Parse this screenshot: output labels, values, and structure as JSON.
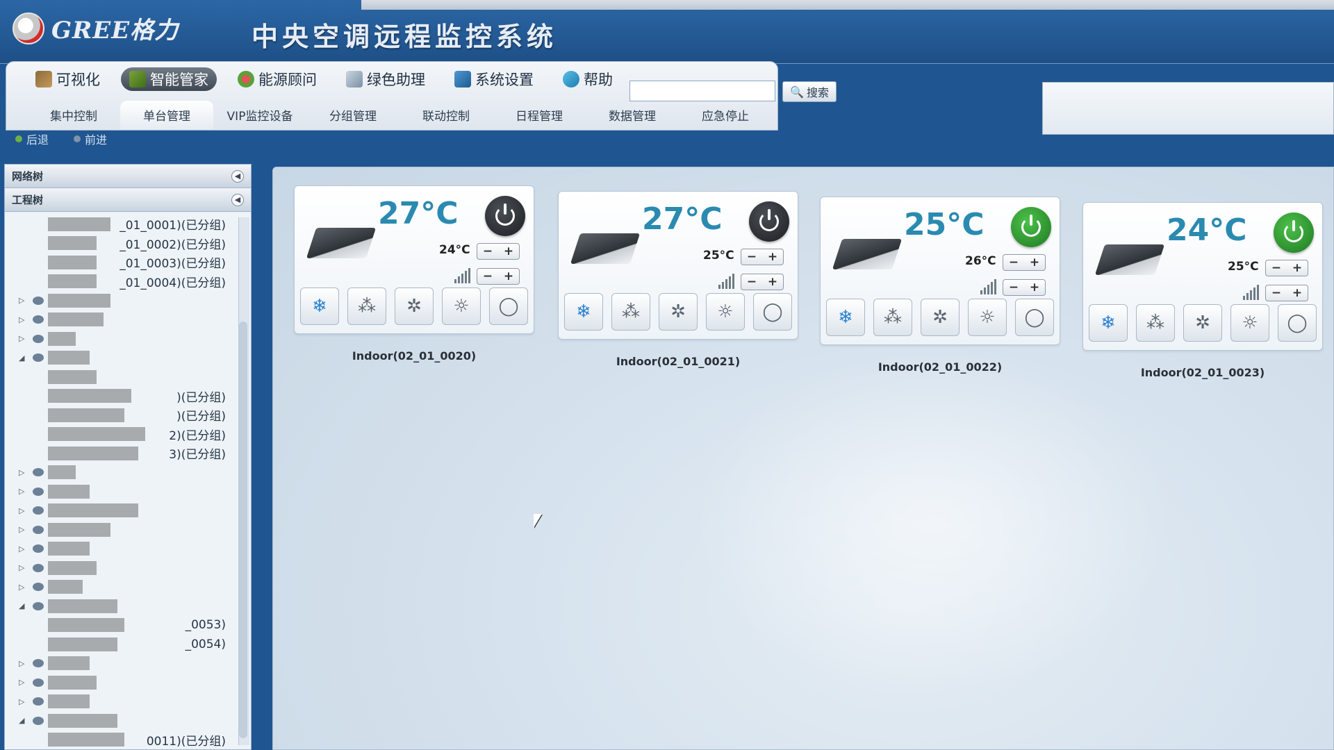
{
  "brand": {
    "logo_text": "GREE格力",
    "system_title": "中央空调远程监控系统"
  },
  "menu": {
    "main_tabs": [
      {
        "label": "可视化",
        "icon": "visualization-icon"
      },
      {
        "label": "智能管家",
        "icon": "smart-manager-icon",
        "active": true
      },
      {
        "label": "能源顾问",
        "icon": "energy-advisor-icon"
      },
      {
        "label": "绿色助理",
        "icon": "green-assistant-icon"
      },
      {
        "label": "系统设置",
        "icon": "system-settings-icon"
      },
      {
        "label": "帮助",
        "icon": "help-icon"
      }
    ],
    "sub_tabs": [
      {
        "label": "集中控制"
      },
      {
        "label": "单台管理",
        "active": true
      },
      {
        "label": "VIP监控设备"
      },
      {
        "label": "分组管理"
      },
      {
        "label": "联动控制"
      },
      {
        "label": "日程管理"
      },
      {
        "label": "数据管理"
      },
      {
        "label": "应急停止"
      }
    ],
    "search": {
      "value": "",
      "button_label": "搜索"
    }
  },
  "nav": {
    "back_label": "后退",
    "forward_label": "前进"
  },
  "sidebar": {
    "network_tree_label": "网络树",
    "project_tree_label": "工程树",
    "tree_items": [
      {
        "label": "_01_0001)(已分组)"
      },
      {
        "label": "_01_0002)(已分组)"
      },
      {
        "label": "_01_0003)(已分组)"
      },
      {
        "label": "_01_0004)(已分组)"
      },
      {
        "label": ""
      },
      {
        "label": ""
      },
      {
        "label": ""
      },
      {
        "label": ""
      },
      {
        "label": ""
      },
      {
        "label": ")(已分组)"
      },
      {
        "label": ")(已分组)"
      },
      {
        "label": "2)(已分组)"
      },
      {
        "label": "3)(已分组)"
      },
      {
        "label": ""
      },
      {
        "label": ""
      },
      {
        "label": ""
      },
      {
        "label": ""
      },
      {
        "label": ""
      },
      {
        "label": ""
      },
      {
        "label": ""
      },
      {
        "label": ""
      },
      {
        "label": "_0053)"
      },
      {
        "label": "_0054)"
      },
      {
        "label": ""
      },
      {
        "label": ""
      },
      {
        "label": ""
      },
      {
        "label": ""
      },
      {
        "label": "0011)(已分组)"
      }
    ]
  },
  "units": [
    {
      "name": "Indoor(02_01_0020)",
      "current_temp": "27°C",
      "set_temp": "24°C",
      "power": "off"
    },
    {
      "name": "Indoor(02_01_0021)",
      "current_temp": "27°C",
      "set_temp": "25°C",
      "power": "off"
    },
    {
      "name": "Indoor(02_01_0022)",
      "current_temp": "25°C",
      "set_temp": "26°C",
      "power": "on"
    },
    {
      "name": "Indoor(02_01_0023)",
      "current_temp": "24°C",
      "set_temp": "25°C",
      "power": "on"
    }
  ],
  "mode_icons": [
    "snowflake-icon",
    "dry-icon",
    "fan-icon",
    "sun-icon",
    "auto-icon"
  ],
  "stepper": {
    "minus": "−",
    "plus": "+"
  },
  "colors": {
    "power_on": "#2e9a2f",
    "power_off": "#2a2e33",
    "temp_text": "#2a8ab0"
  }
}
